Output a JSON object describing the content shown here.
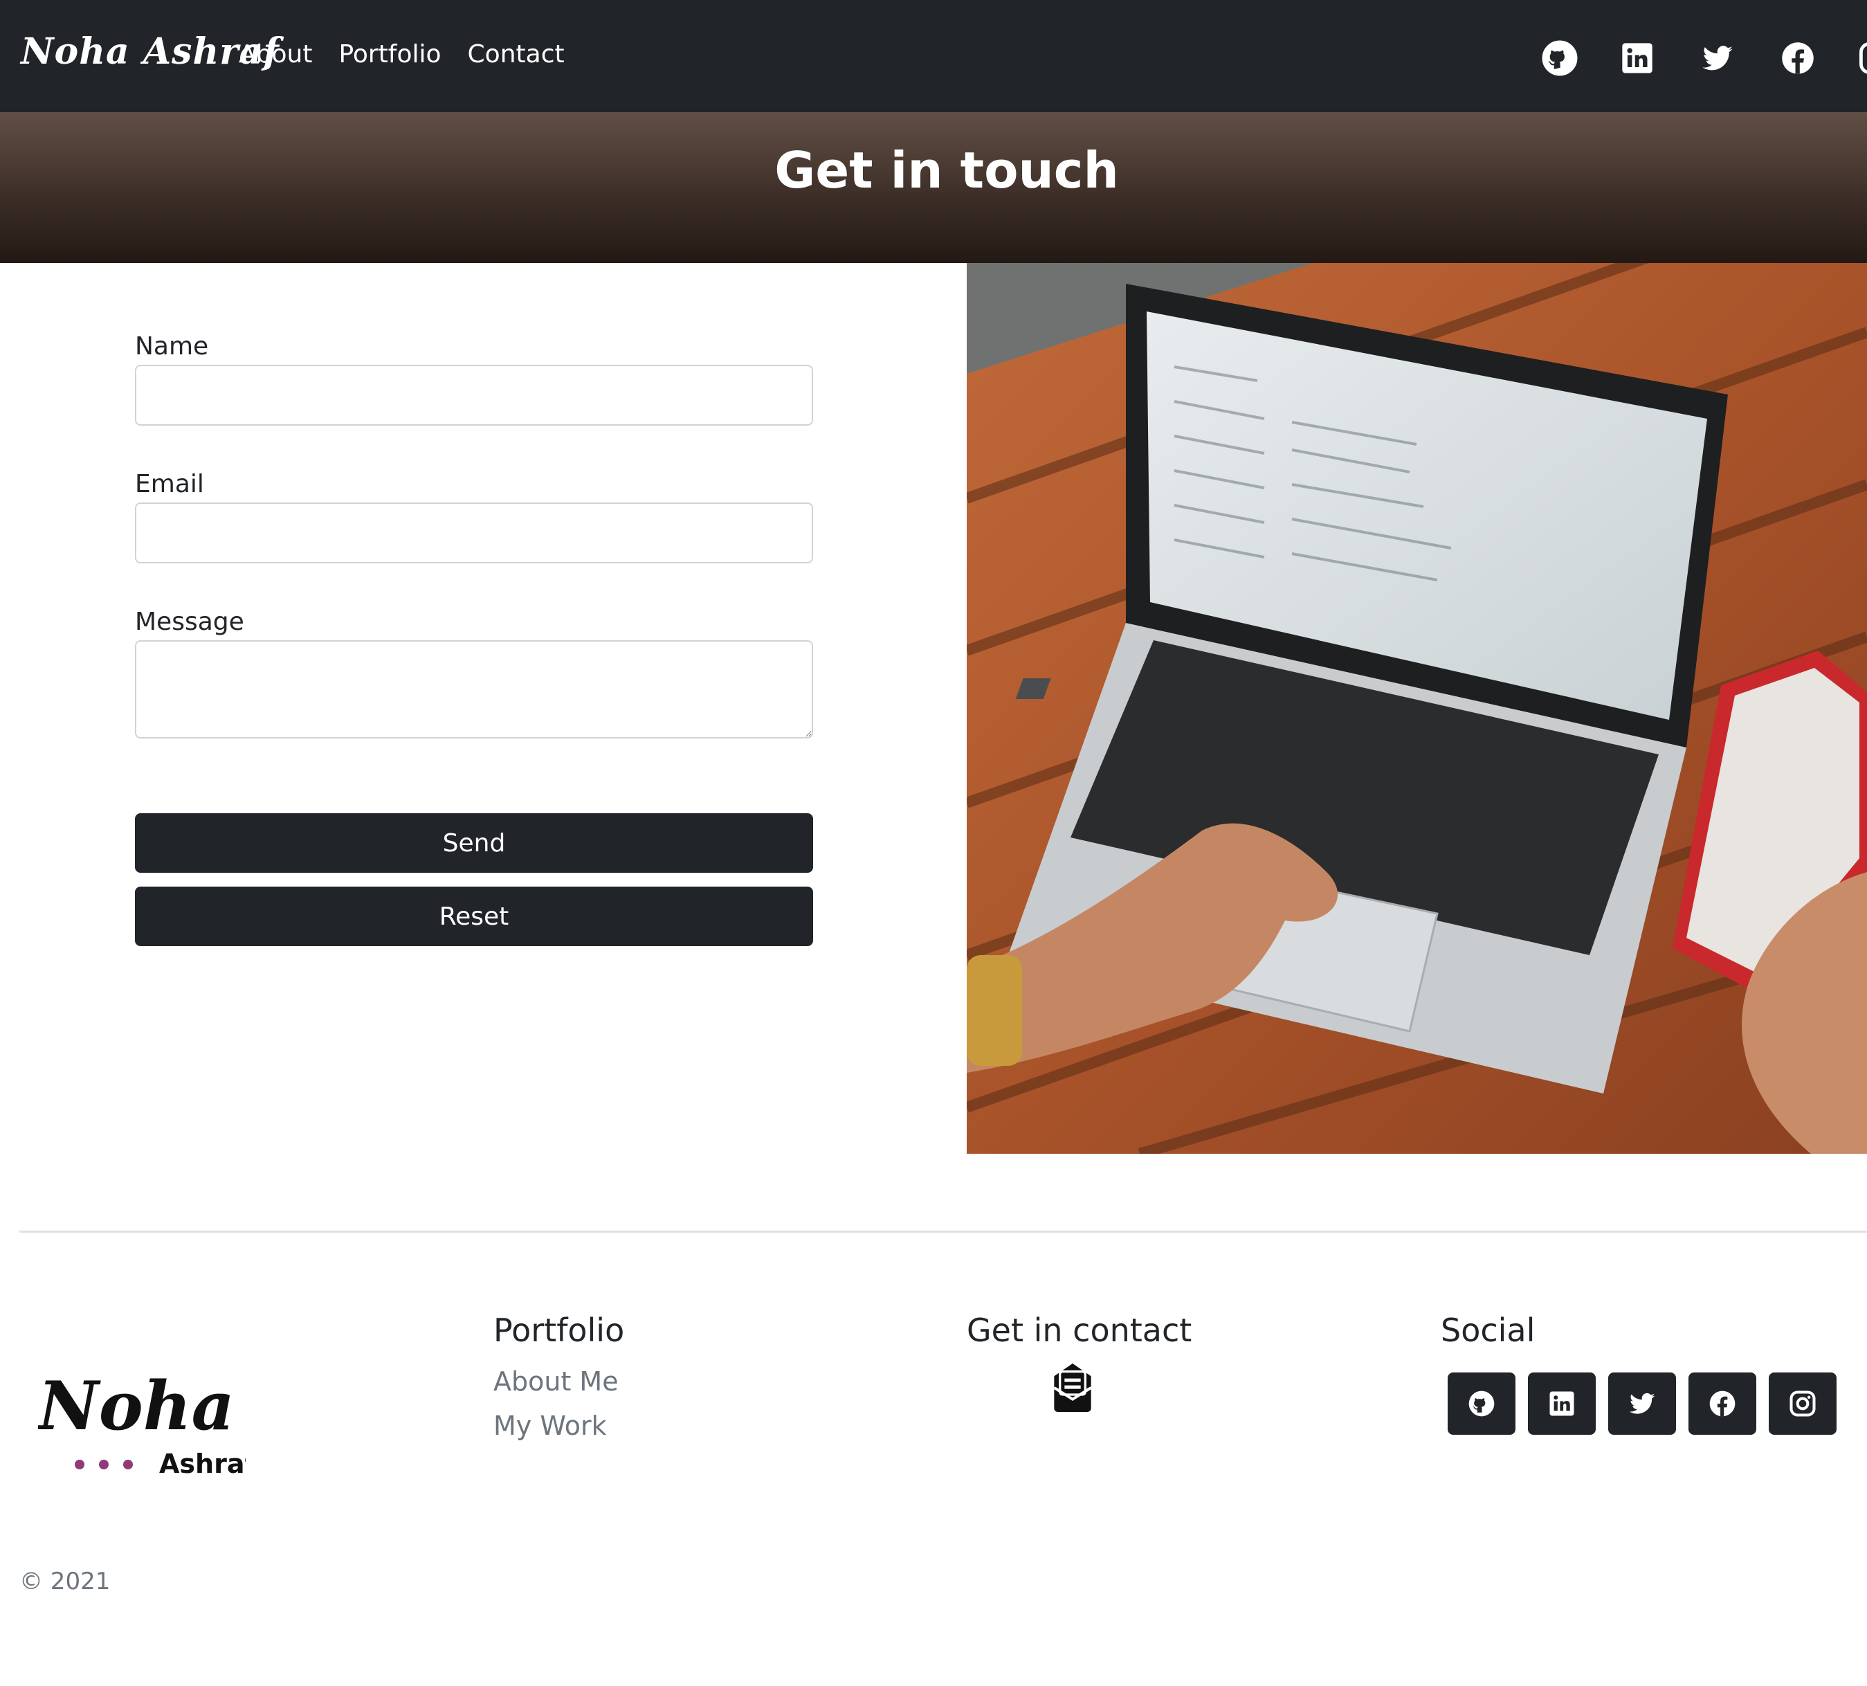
{
  "nav": {
    "brand": "Noha Ashraf",
    "links": [
      "About",
      "Portfolio",
      "Contact"
    ],
    "social_icons": [
      "github-icon",
      "linkedin-icon",
      "twitter-icon",
      "facebook-icon",
      "instagram-icon"
    ]
  },
  "header": {
    "title": "Get in touch"
  },
  "form": {
    "name_label": "Name",
    "name_value": "",
    "email_label": "Email",
    "email_value": "",
    "message_label": "Message",
    "message_value": "",
    "send_label": "Send",
    "reset_label": "Reset"
  },
  "footer": {
    "logo_main": "Noha",
    "logo_sub": "Ashraf",
    "portfolio_title": "Portfolio",
    "portfolio_links": [
      "About Me",
      "My Work"
    ],
    "contact_title": "Get in contact",
    "social_title": "Social",
    "copyright": "© 2021"
  },
  "colors": {
    "dark": "#212529",
    "muted": "#6c757d",
    "hero_top": "#614f45",
    "hero_bottom": "#231914",
    "logo_dots": "#8e3a7c"
  }
}
